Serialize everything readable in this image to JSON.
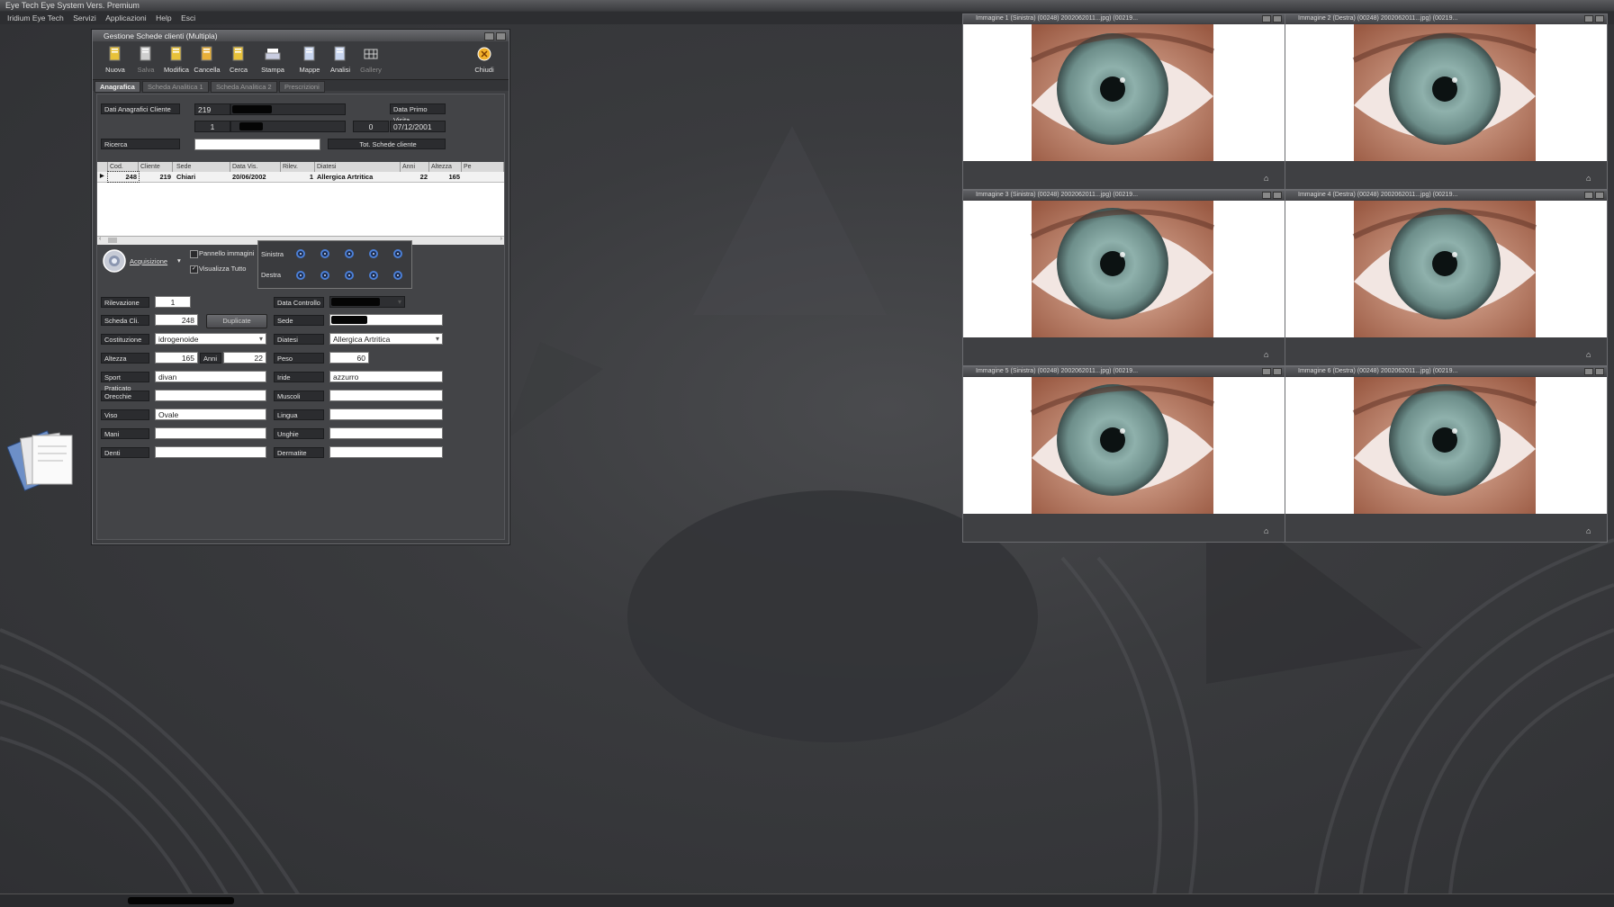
{
  "app": {
    "title": "Eye Tech Eye System Vers. Premium"
  },
  "menu": [
    "Iridium Eye Tech",
    "Servizi",
    "Applicazioni",
    "Help",
    "Esci"
  ],
  "window": {
    "title": "Gestione Schede clienti (Multipla)"
  },
  "toolbar": [
    {
      "label": "Nuova",
      "icon": "new-doc-icon",
      "enabled": true
    },
    {
      "label": "Salva",
      "icon": "save-icon",
      "enabled": false
    },
    {
      "label": "Modifica",
      "icon": "edit-icon",
      "enabled": true
    },
    {
      "label": "Cancella",
      "icon": "delete-icon",
      "enabled": true
    },
    {
      "label": "Cerca",
      "icon": "search-icon",
      "enabled": true
    },
    {
      "label": "Stampa",
      "icon": "print-icon",
      "enabled": true
    },
    {
      "label": "Mappe",
      "icon": "map-icon",
      "enabled": true
    },
    {
      "label": "Analisi",
      "icon": "analysis-icon",
      "enabled": true
    },
    {
      "label": "Gallery",
      "icon": "gallery-icon",
      "enabled": false
    },
    {
      "label": "Chiudi",
      "icon": "close-icon",
      "enabled": true
    }
  ],
  "tabs": [
    "Anagrafica",
    "Scheda Analitica 1",
    "Scheda Analitica 2",
    "Prescrizioni"
  ],
  "header": {
    "dati_label": "Dati Anagrafici Cliente",
    "id": "219",
    "num": "1",
    "zero": "0",
    "data_primo_label": "Data Primo Visita",
    "data_primo_value": "07/12/2001",
    "ricerca_label": "Ricerca",
    "ricerca_value": "",
    "tot_button": "Tot. Schede cliente"
  },
  "table": {
    "columns": [
      "Cod.",
      "Cliente",
      "Sede",
      "Data Vis.",
      "Rilev.",
      "Diatesi",
      "Anni",
      "Altezza",
      "Pe"
    ],
    "rows": [
      [
        "248",
        "219",
        "Chiari",
        "20/06/2002",
        "1",
        "Allergica Artritica",
        "22",
        "165",
        ""
      ]
    ]
  },
  "acquisition": {
    "button": "Acquisizione",
    "pannello": "Pannello immagini",
    "visualizza": "Visualizza Tutto",
    "sinistra": "Sinistra",
    "destra": "Destra"
  },
  "form": {
    "rilevazione": {
      "label": "Rilevazione",
      "value": "1"
    },
    "scheda_cli": {
      "label": "Scheda Cli.",
      "value": "248"
    },
    "duplicate": "Duplicate",
    "costituzione": {
      "label": "Costituzione",
      "value": "idrogenoide"
    },
    "altezza": {
      "label": "Altezza",
      "value": "165"
    },
    "anni": {
      "label": "Anni",
      "value": "22"
    },
    "sport": {
      "label": "Sport Praticato",
      "value": "divan"
    },
    "orecchie": {
      "label": "Orecchie",
      "value": ""
    },
    "viso": {
      "label": "Viso",
      "value": "Ovale"
    },
    "mani": {
      "label": "Mani",
      "value": ""
    },
    "denti": {
      "label": "Denti",
      "value": ""
    },
    "data_controllo": {
      "label": "Data Controllo",
      "value": ""
    },
    "sede": {
      "label": "Sede",
      "value": ""
    },
    "diatesi": {
      "label": "Diatesi",
      "value": "Allergica Artritica"
    },
    "peso": {
      "label": "Peso",
      "value": "60"
    },
    "iride": {
      "label": "Iride",
      "value": "azzurro"
    },
    "muscoli": {
      "label": "Muscoli",
      "value": ""
    },
    "lingua": {
      "label": "Lingua",
      "value": ""
    },
    "unghie": {
      "label": "Unghie",
      "value": ""
    },
    "dermatite": {
      "label": "Dermatite",
      "value": ""
    }
  },
  "viewers": [
    {
      "title": "Immagine 1 (Sinistra) (00248) 2002062011...jpg) (00219..."
    },
    {
      "title": "Immagine 2 (Destra) (00248) 2002062011...jpg) (00219..."
    },
    {
      "title": "Immagine 3 (Sinistra) (00248) 2002062011...jpg) (00219..."
    },
    {
      "title": "Immagine 4 (Destra) (00248) 2002062011...jpg) (00219..."
    },
    {
      "title": "Immagine 5 (Sinistra) (00248) 2002062011...jpg) (00219..."
    },
    {
      "title": "Immagine 6 (Destra) (00248) 2002062011...jpg) (00219..."
    }
  ]
}
